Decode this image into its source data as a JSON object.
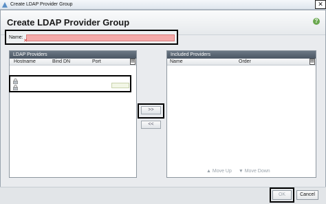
{
  "window": {
    "title": "Create LDAP Provider Group",
    "close_label": "✕"
  },
  "dialog": {
    "heading": "Create LDAP Provider Group",
    "help_label": "?"
  },
  "form": {
    "name_label": "Name:",
    "name_value": "",
    "name_error_mark": "✕"
  },
  "ldap_panel": {
    "title": "LDAP Providers",
    "columns": [
      "Hostname",
      "Bind DN",
      "Port"
    ],
    "menu_label": "▤"
  },
  "included_panel": {
    "title": "Included Providers",
    "columns": [
      "Name",
      "Order"
    ],
    "menu_label": "▤",
    "move_up": "▲ Move Up",
    "move_down": "▼ Move Down"
  },
  "buttons": {
    "add": ">>",
    "remove": "<<",
    "ok": "OK",
    "cancel": "Cancel"
  },
  "colors": {
    "header_bar": "#55616d",
    "required_field": "#f4a9a9",
    "highlight_border": "#000000"
  }
}
